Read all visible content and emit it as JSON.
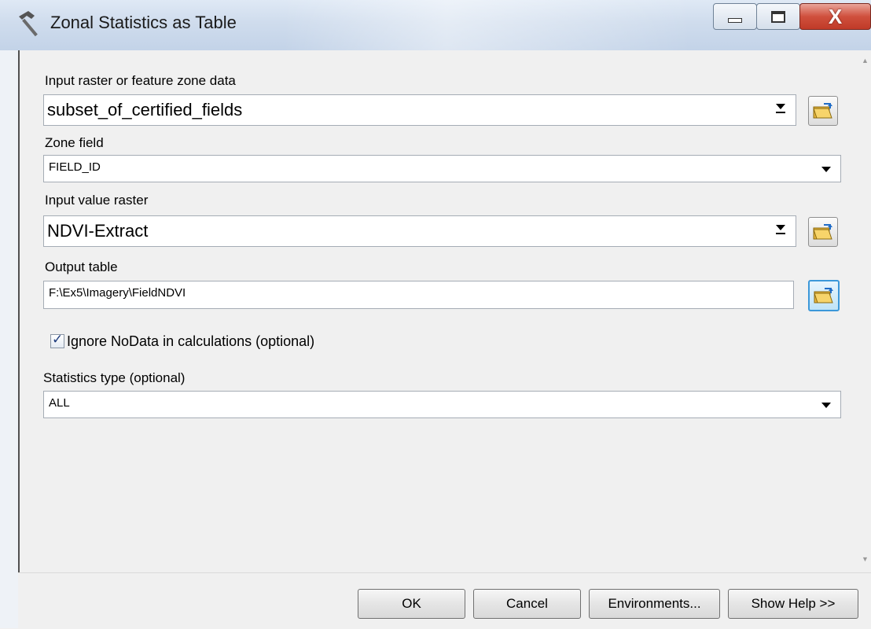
{
  "window": {
    "title": "Zonal Statistics as Table",
    "icon": "hammer-icon",
    "close_glyph": "X"
  },
  "form": {
    "input_zone": {
      "label": "Input raster or feature zone data",
      "value": "subset_of_certified_fields",
      "browse_icon": "folder-open-icon"
    },
    "zone_field": {
      "label": "Zone field",
      "value": "FIELD_ID"
    },
    "input_value_raster": {
      "label": "Input value raster",
      "value": "NDVI-Extract",
      "browse_icon": "folder-open-icon"
    },
    "output_table": {
      "label": "Output table",
      "value": "F:\\Ex5\\Imagery\\FieldNDVI",
      "browse_icon": "folder-open-icon"
    },
    "ignore_nodata": {
      "label": "Ignore NoData in calculations (optional)",
      "checked": true
    },
    "statistics_type": {
      "label": "Statistics type (optional)",
      "value": "ALL"
    }
  },
  "buttons": {
    "ok": "OK",
    "cancel": "Cancel",
    "environments": "Environments...",
    "show_help": "Show Help >>"
  },
  "colors": {
    "accent_focus": "#3c98d9",
    "close_red": "#c03a28"
  }
}
